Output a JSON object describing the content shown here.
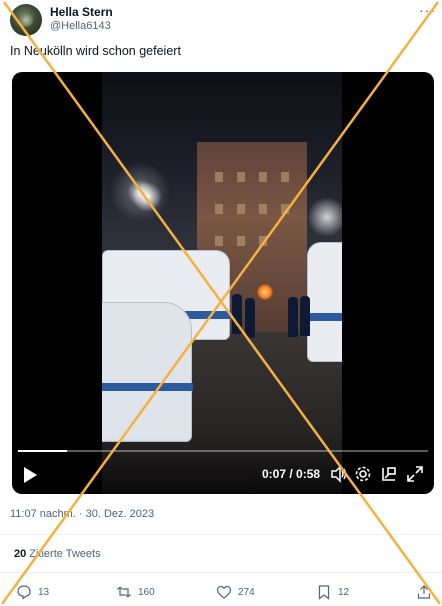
{
  "author": {
    "name": "Hella Stern",
    "handle": "@Hella6143",
    "avatar_icon": "user-avatar"
  },
  "more_icon": "more-dots-icon",
  "tweet": {
    "text": "In Neukölln wird schon gefeiert"
  },
  "video": {
    "time_current": "0:07",
    "time_total": "0:58",
    "time_display": "0:07 / 0:58",
    "progress_fraction": 0.12,
    "controls": [
      "play-icon",
      "volume-icon",
      "settings-icon",
      "pip-icon",
      "fullscreen-icon"
    ]
  },
  "timestamp": "11:07 nachm. · 30. Dez. 2023",
  "quotes": {
    "count": "20",
    "label": "Zitierte Tweets"
  },
  "actions": {
    "replies": "13",
    "retweets": "160",
    "likes": "274",
    "bookmarks": "12"
  },
  "overlay": {
    "cross_color": "#f5b041"
  }
}
